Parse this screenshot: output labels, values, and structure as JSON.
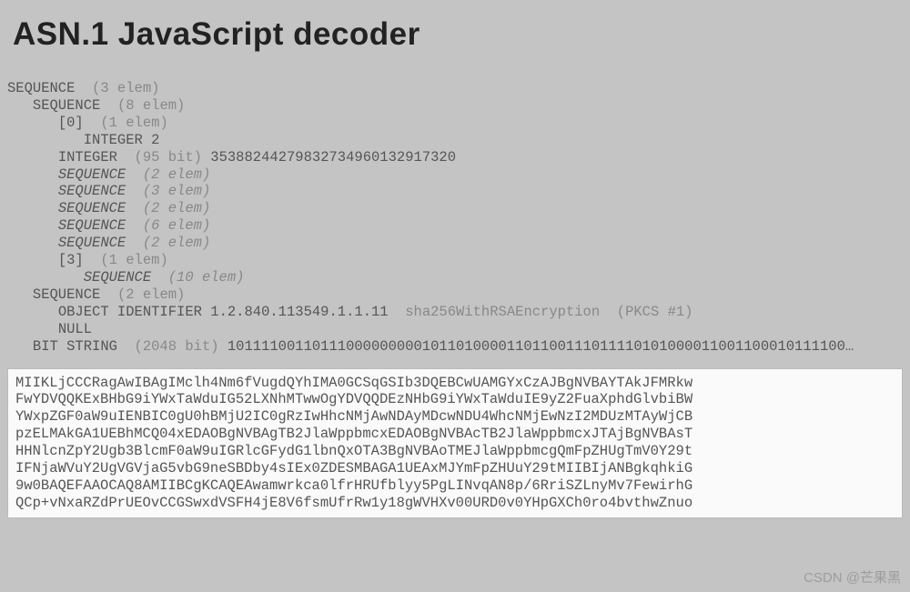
{
  "title": "ASN.1 JavaScript decoder",
  "tree": [
    {
      "indent": 0,
      "tag": "SEQUENCE",
      "ital": false,
      "elem": "(3 elem)"
    },
    {
      "indent": 1,
      "tag": "SEQUENCE",
      "ital": false,
      "elem": "(8 elem)"
    },
    {
      "indent": 2,
      "tag": "[0]",
      "ital": false,
      "elem": "(1 elem)"
    },
    {
      "indent": 3,
      "tag": "INTEGER",
      "ital": false,
      "val": "2"
    },
    {
      "indent": 2,
      "tag": "INTEGER",
      "ital": false,
      "elem": "(95 bit)",
      "val": "35388244279832734960132917320"
    },
    {
      "indent": 2,
      "tag": "SEQUENCE",
      "ital": true,
      "elem": "(2 elem)"
    },
    {
      "indent": 2,
      "tag": "SEQUENCE",
      "ital": true,
      "elem": "(3 elem)"
    },
    {
      "indent": 2,
      "tag": "SEQUENCE",
      "ital": true,
      "elem": "(2 elem)"
    },
    {
      "indent": 2,
      "tag": "SEQUENCE",
      "ital": true,
      "elem": "(6 elem)"
    },
    {
      "indent": 2,
      "tag": "SEQUENCE",
      "ital": true,
      "elem": "(2 elem)"
    },
    {
      "indent": 2,
      "tag": "[3]",
      "ital": false,
      "elem": "(1 elem)"
    },
    {
      "indent": 3,
      "tag": "SEQUENCE",
      "ital": true,
      "elem": "(10 elem)"
    },
    {
      "indent": 1,
      "tag": "SEQUENCE",
      "ital": false,
      "elem": "(2 elem)"
    },
    {
      "indent": 2,
      "tag": "OBJECT IDENTIFIER",
      "ital": false,
      "val": "1.2.840.113549.1.1.11",
      "desc": "sha256WithRSAEncryption",
      "src": "(PKCS #1)"
    },
    {
      "indent": 2,
      "tag": "NULL",
      "ital": false
    },
    {
      "indent": 1,
      "tag": "BIT STRING",
      "ital": false,
      "elem": "(2048 bit)",
      "val": "1011110011011100000000010110100001101100111011110101000011001100010111100…"
    }
  ],
  "hex": [
    "MIIKLjCCCRagAwIBAgIMclh4Nm6fVugdQYhIMA0GCSqGSIb3DQEBCwUAMGYxCzAJBgNVBAYTAkJFMRkw",
    "FwYDVQQKExBHbG9iYWxTaWduIG52LXNhMTwwOgYDVQQDEzNHbG9iYWxTaWduIE9yZ2FuaXphdGlvbiBW",
    "YWxpZGF0aW9uIENBIC0gU0hBMjU2IC0gRzIwHhcNMjAwNDAyMDcwNDU4WhcNMjEwNzI2MDUzMTAyWjCB",
    "pzELMAkGA1UEBhMCQ04xEDAOBgNVBAgTB2JlaWppbmcxEDAOBgNVBAcTB2JlaWppbmcxJTAjBgNVBAsT",
    "HHNlcnZpY2Ugb3BlcmF0aW9uIGRlcGFydG1lbnQxOTA3BgNVBAoTMEJlaWppbmcgQmFpZHUgTmV0Y29t",
    "IFNjaWVuY2UgVGVjaG5vbG9neSBDby4sIEx0ZDESMBAGA1UEAxMJYmFpZHUuY29tMIIBIjANBgkqhkiG",
    "9w0BAQEFAAOCAQ8AMIIBCgKCAQEAwamwrkca0lfrHRUfblyy5PgLINvqAN8p/6RriSZLnyMv7FewirhG",
    "QCp+vNxaRZdPrUEOvCCGSwxdVSFH4jE8V6fsmUfrRw1y18gWVHXv00URD0v0YHpGXCh0ro4bvthwZnuo"
  ],
  "watermark": "CSDN @芒果黑"
}
